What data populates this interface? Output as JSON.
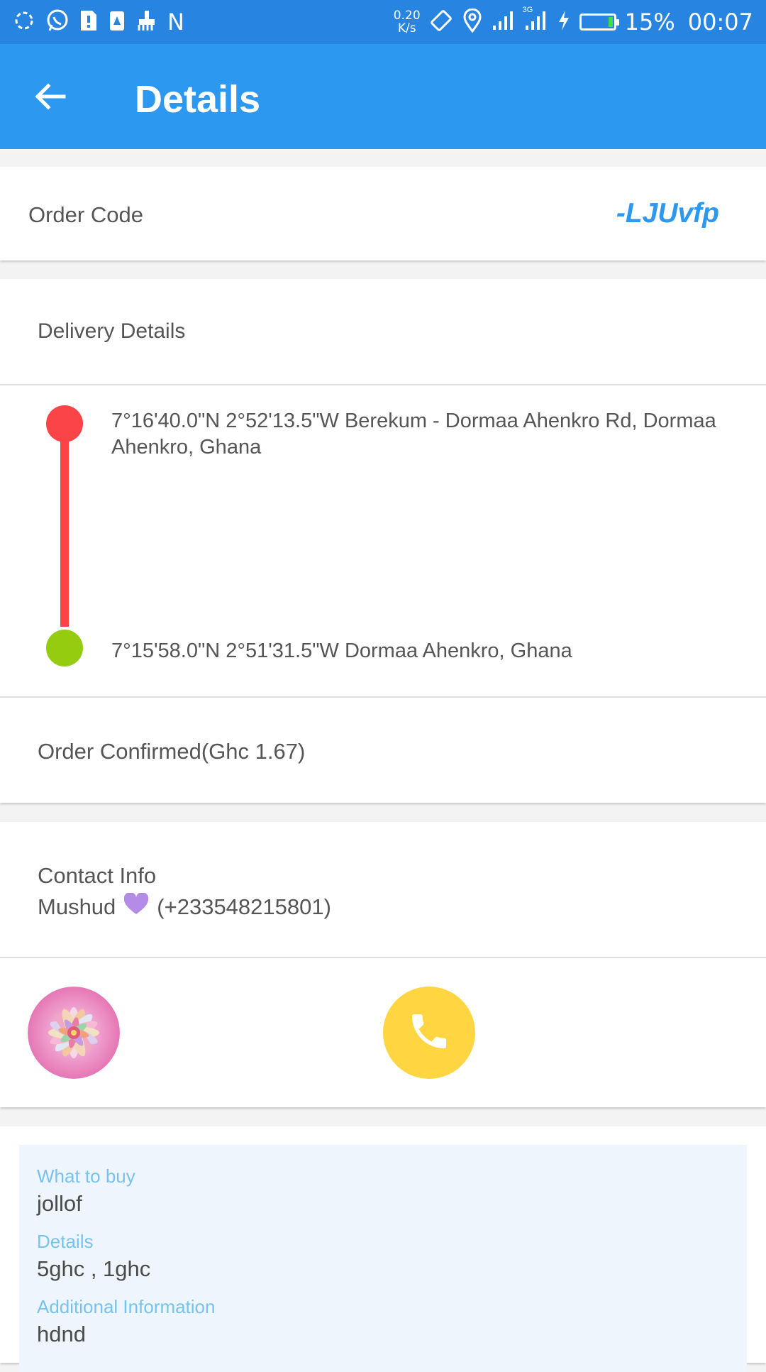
{
  "status_bar": {
    "speed_value": "0.20",
    "speed_unit": "K/s",
    "network_label": "3G",
    "battery_percent": "15%",
    "battery_level": 0.15,
    "time": "00:07",
    "n_label": "N",
    "icons": [
      "sync-icon",
      "whatsapp-icon",
      "sim-card-icon",
      "battery-saver-icon",
      "cleaner-icon",
      "notification-n-icon",
      "rotate-icon",
      "location-icon",
      "signal-icon",
      "signal-3g-icon",
      "charging-icon",
      "battery-icon"
    ]
  },
  "app_bar": {
    "title": "Details",
    "back_icon": "arrow-left-icon",
    "background": "#2c98f0"
  },
  "order": {
    "label": "Order Code",
    "code": "-LJUvfp",
    "code_color": "#2c98f0"
  },
  "delivery": {
    "section_label": "Delivery Details",
    "pickup_address": "7°16'40.0\"N 2°52'13.5\"W Berekum - Dormaa Ahenkro Rd, Dormaa Ahenkro, Ghana",
    "dropoff_address": "7°15'58.0\"N 2°51'31.5\"W Dormaa Ahenkro, Ghana",
    "pickup_color": "#fb4447",
    "dropoff_color": "#95cc10",
    "status_text": "Order Confirmed(Ghc 1.67)"
  },
  "contact": {
    "heading": "Contact Info",
    "name": "Mushud",
    "phone": "(+233548215801)",
    "emoji_icon": "purple-heart-icon",
    "call_icon": "phone-icon",
    "call_color": "#ffd541"
  },
  "request": {
    "what_to_buy_label": "What to buy",
    "what_to_buy_value": "jollof",
    "details_label": "Details",
    "details_value": "5ghc , 1ghc",
    "additional_label": "Additional Information",
    "additional_value": "hdnd"
  }
}
